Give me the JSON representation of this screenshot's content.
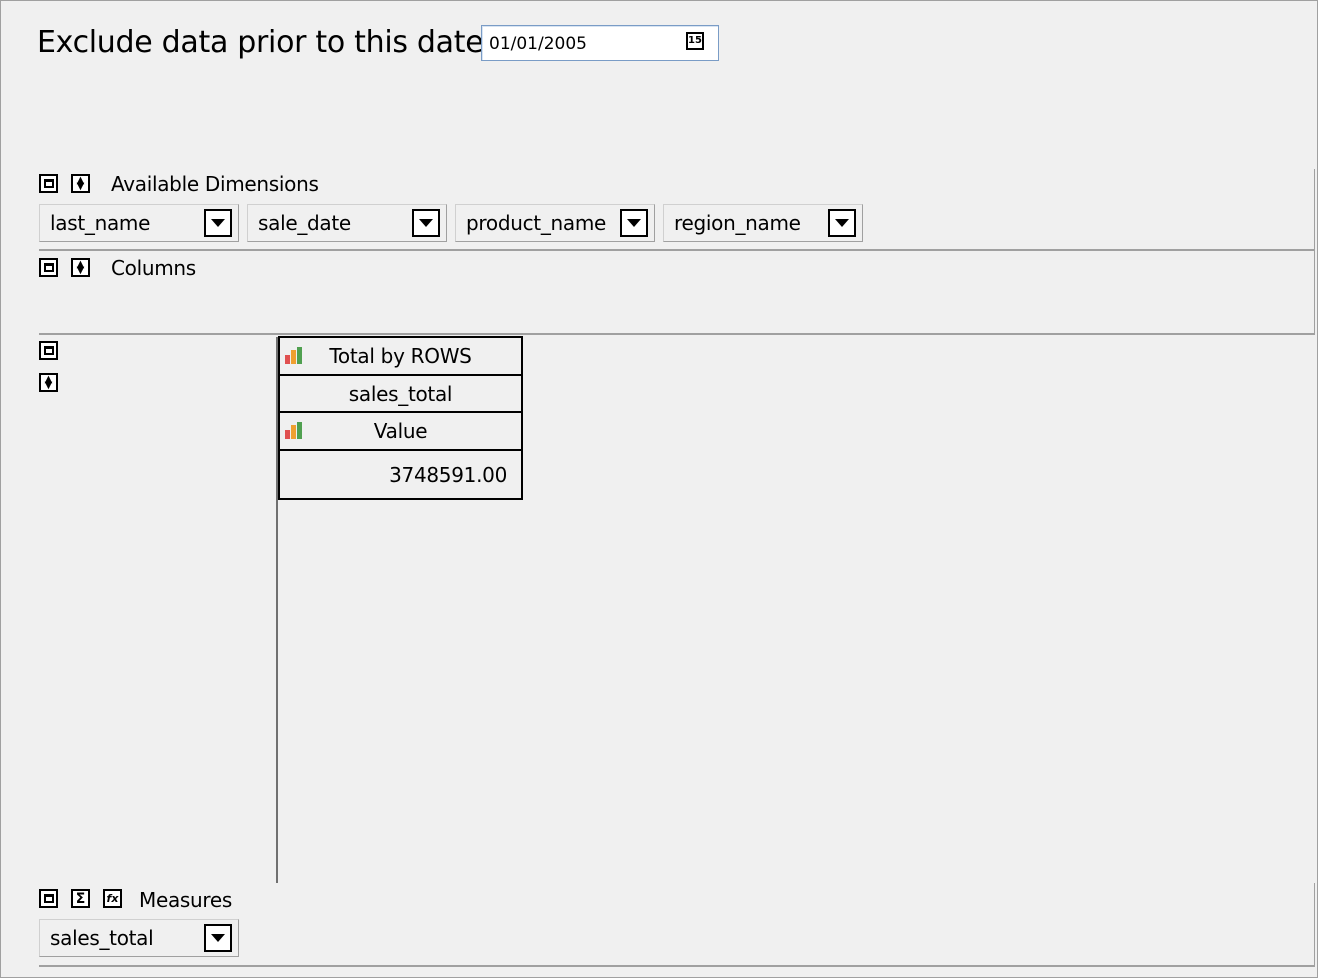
{
  "filter": {
    "label": "Exclude data prior to this date",
    "date_value": "01/01/2005",
    "calendar_icon_text": "15"
  },
  "available_dimensions": {
    "label": "Available Dimensions",
    "items": [
      {
        "label": "last_name"
      },
      {
        "label": "sale_date"
      },
      {
        "label": "product_name"
      },
      {
        "label": "region_name"
      }
    ]
  },
  "columns": {
    "label": "Columns"
  },
  "result_table": {
    "header": "Total by ROWS",
    "measure_name": "sales_total",
    "value_header": "Value",
    "value": "3748591.00"
  },
  "measures": {
    "label": "Measures",
    "selected": "sales_total"
  },
  "icons": {
    "panel_toggle": "window-toggle-icon",
    "sort": "up-down-arrows-icon",
    "sum": "sigma-icon",
    "formula": "fx-icon",
    "dropdown": "chevron-down-icon",
    "calendar": "calendar-icon",
    "chart": "bar-chart-icon"
  }
}
